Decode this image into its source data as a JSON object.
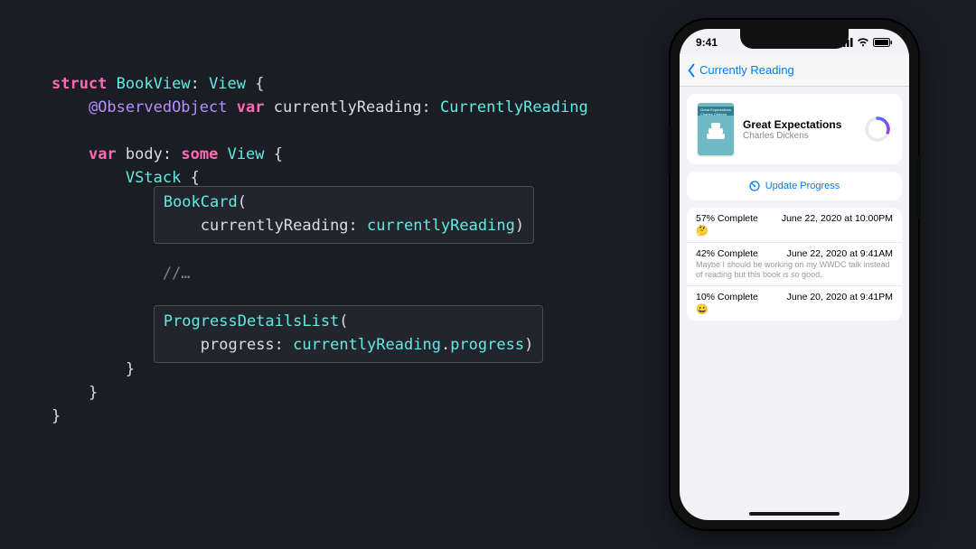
{
  "code": {
    "l1_kw": "struct",
    "l1_name": "BookView",
    "l1_proto": "View",
    "l2_attr": "@ObservedObject",
    "l2_kw": "var",
    "l2_name": "currentlyReading",
    "l2_type": "CurrentlyReading",
    "l3_kw": "var",
    "l3_name": "body",
    "l3_some": "some",
    "l3_ret": "View",
    "l4_vstack": "VStack",
    "box1_call": "BookCard",
    "box1_label": "currentlyReading",
    "box1_arg": "currentlyReading",
    "comment": "//…",
    "box2_call": "ProgressDetailsList",
    "box2_label": "progress",
    "box2_arg_recv": "currentlyReading",
    "box2_arg_prop": "progress"
  },
  "phone": {
    "time": "9:41",
    "nav_back": "Currently Reading",
    "book": {
      "title": "Great Expectations",
      "author": "Charles Dickens",
      "cover_text": "Great\nExpectations\nCharles Dickens"
    },
    "update_label": "Update Progress",
    "rows": [
      {
        "pct": "57% Complete",
        "date": "June 22, 2020 at 10:00PM",
        "emoji": "🤔",
        "note": ""
      },
      {
        "pct": "42% Complete",
        "date": "June 22, 2020 at 9:41AM",
        "emoji": "",
        "note": "Maybe I should be working on my WWDC talk instead of reading but this book is so good."
      },
      {
        "pct": "10% Complete",
        "date": "June 20, 2020 at 9:41PM",
        "emoji": "😀",
        "note": ""
      }
    ]
  }
}
